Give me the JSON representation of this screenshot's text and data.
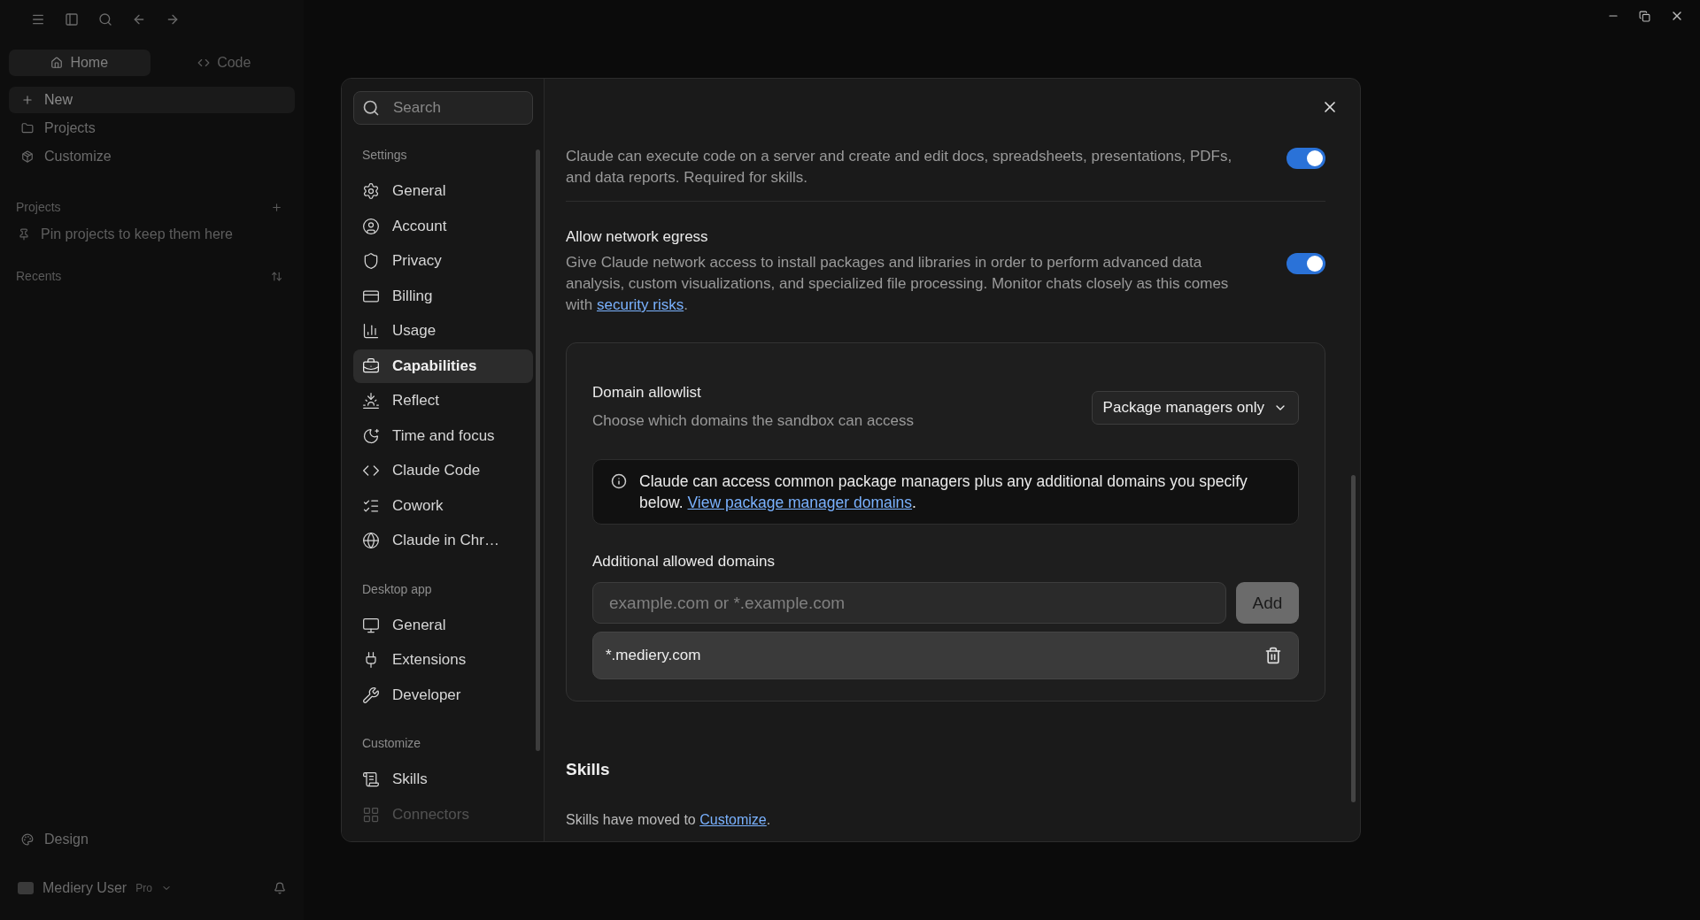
{
  "background": {
    "tabs": [
      {
        "label": "Home",
        "selected": true
      },
      {
        "label": "Code",
        "selected": false
      }
    ],
    "items": [
      {
        "label": "New",
        "selected": true
      },
      {
        "label": "Projects",
        "selected": false
      },
      {
        "label": "Customize",
        "selected": false
      }
    ],
    "projects_heading": "Projects",
    "projects_hint": "Pin projects to keep them here",
    "recents_heading": "Recents",
    "footer_item": "Design",
    "user": {
      "name": "Mediery User",
      "plan": "Pro"
    }
  },
  "settings": {
    "search": {
      "placeholder": "Search"
    },
    "sections": [
      {
        "heading": "Settings",
        "items": [
          {
            "label": "General",
            "selected": false
          },
          {
            "label": "Account",
            "selected": false
          },
          {
            "label": "Privacy",
            "selected": false
          },
          {
            "label": "Billing",
            "selected": false
          },
          {
            "label": "Usage",
            "selected": false
          },
          {
            "label": "Capabilities",
            "selected": true
          },
          {
            "label": "Reflect",
            "selected": false
          },
          {
            "label": "Time and focus",
            "selected": false
          },
          {
            "label": "Claude Code",
            "selected": false
          },
          {
            "label": "Cowork",
            "selected": false
          },
          {
            "label": "Claude in Chr…",
            "selected": false
          }
        ]
      },
      {
        "heading": "Desktop app",
        "items": [
          {
            "label": "General",
            "selected": false
          },
          {
            "label": "Extensions",
            "selected": false
          },
          {
            "label": "Developer",
            "selected": false
          }
        ]
      },
      {
        "heading": "Customize",
        "items": [
          {
            "label": "Skills",
            "selected": false
          },
          {
            "label": "Connectors",
            "selected": false
          }
        ]
      }
    ]
  },
  "content": {
    "toggles": [
      {
        "description": "Claude can execute code on a server and create and edit docs, spreadsheets, presentations, PDFs, and data reports. Required for skills.",
        "on": true
      },
      {
        "title": "Allow network egress",
        "description": "Give Claude network access to install packages and libraries in order to perform advanced data analysis, custom visualizations, and specialized file processing. Monitor chats closely as this comes with ",
        "link": "security risks",
        "suffix": ".",
        "on": true
      }
    ],
    "domain_allowlist": {
      "title": "Domain allowlist",
      "subtitle": "Choose which domains the sandbox can access",
      "dropdown": "Package managers only",
      "info": {
        "text": "Claude can access common package managers plus any additional domains you specify below. ",
        "link": "View package manager domains",
        "suffix": "."
      },
      "additional_label": "Additional allowed domains",
      "input": {
        "placeholder": "example.com or *.example.com"
      },
      "add_button": "Add",
      "domains": [
        "*.mediery.com"
      ]
    },
    "skills": {
      "heading": "Skills",
      "text": "Skills have moved to ",
      "link": "Customize",
      "suffix": "."
    }
  }
}
